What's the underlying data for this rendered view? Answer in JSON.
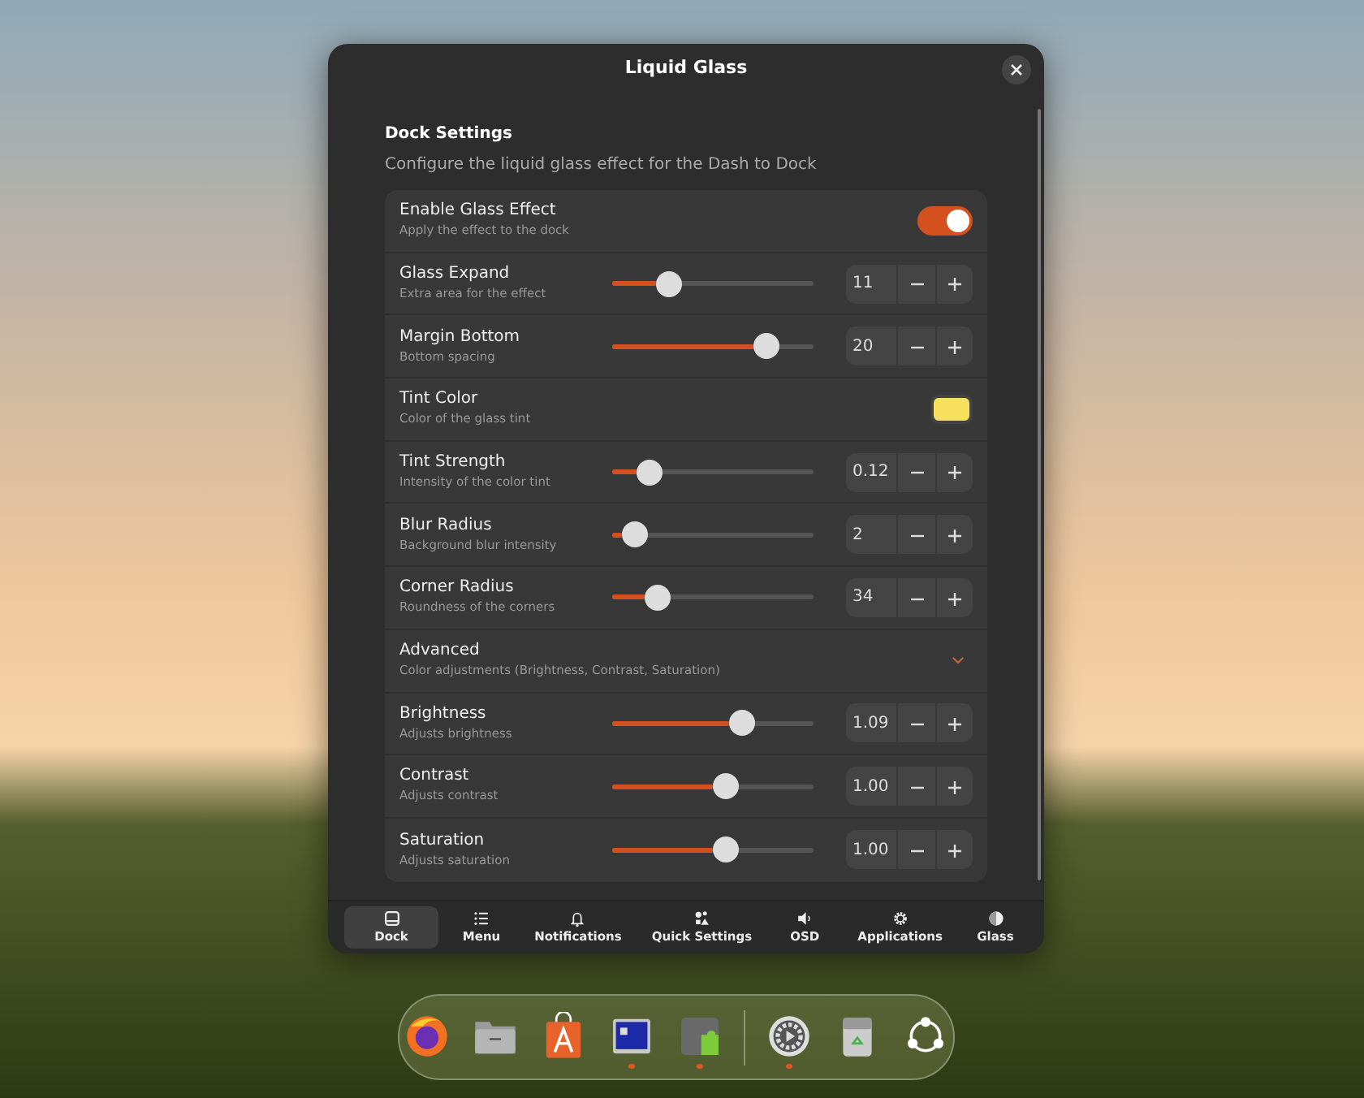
{
  "window": {
    "title": "Liquid Glass"
  },
  "section": {
    "title": "Dock Settings",
    "description": "Configure the liquid glass effect for the Dash to Dock"
  },
  "rows": [
    {
      "kind": "toggle",
      "label": "Enable Glass Effect",
      "subtitle": "Apply the effect to the dock",
      "on": true
    },
    {
      "kind": "slider",
      "label": "Glass Expand",
      "subtitle": "Extra area for the effect",
      "level": 0.22,
      "value": "11"
    },
    {
      "kind": "slider",
      "label": "Margin Bottom",
      "subtitle": "Bottom spacing",
      "level": 0.7,
      "value": "20"
    },
    {
      "kind": "color",
      "label": "Tint Color",
      "subtitle": "Color of the glass tint",
      "color": "#f6e05e"
    },
    {
      "kind": "slider",
      "label": "Tint Strength",
      "subtitle": "Intensity of the color tint",
      "level": 0.12,
      "value": "0.12"
    },
    {
      "kind": "slider",
      "label": "Blur Radius",
      "subtitle": "Background blur intensity",
      "level": 0.05,
      "value": "2"
    },
    {
      "kind": "slider",
      "label": "Corner Radius",
      "subtitle": "Roundness of the corners",
      "level": 0.16,
      "value": "34"
    },
    {
      "kind": "expander",
      "label": "Advanced",
      "subtitle": "Color adjustments (Brightness, Contrast, Saturation)",
      "expanded": true
    },
    {
      "kind": "slider",
      "label": "Brightness",
      "subtitle": "Adjusts brightness",
      "level": 0.58,
      "value": "1.09"
    },
    {
      "kind": "slider",
      "label": "Contrast",
      "subtitle": "Adjusts contrast",
      "level": 0.5,
      "value": "1.00"
    },
    {
      "kind": "slider",
      "label": "Saturation",
      "subtitle": "Adjusts saturation",
      "level": 0.5,
      "value": "1.00"
    }
  ],
  "tabs": [
    {
      "label": "Dock",
      "selected": true
    },
    {
      "label": "Menu",
      "selected": false
    },
    {
      "label": "Notifications",
      "selected": false
    },
    {
      "label": "Quick Settings",
      "selected": false
    },
    {
      "label": "OSD",
      "selected": false
    },
    {
      "label": "Applications",
      "selected": false
    },
    {
      "label": "Glass",
      "selected": false
    }
  ],
  "dock": [
    {
      "kind": "app",
      "running": false
    },
    {
      "kind": "app",
      "running": false
    },
    {
      "kind": "app",
      "running": false
    },
    {
      "kind": "app",
      "running": true
    },
    {
      "kind": "app",
      "running": true
    },
    {
      "kind": "separator"
    },
    {
      "kind": "app",
      "running": true
    },
    {
      "kind": "app",
      "running": false
    },
    {
      "kind": "app",
      "running": false
    }
  ]
}
